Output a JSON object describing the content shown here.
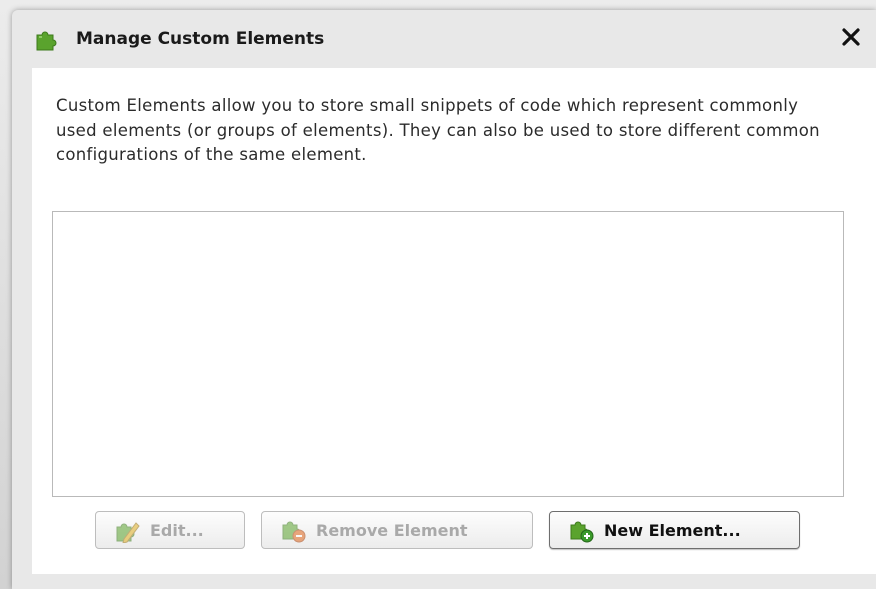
{
  "dialog": {
    "title": "Manage Custom Elements",
    "close_symbol": "✕",
    "title_icon": "puzzle-icon",
    "description": "Custom Elements allow you to store small snippets of code which represent commonly used elements (or groups of elements).  They can also be used to store different common configurations of the same element.",
    "list_items": []
  },
  "buttons": {
    "edit_label": "Edit...",
    "remove_label": "Remove Element",
    "new_label": "New Element..."
  },
  "colors": {
    "puzzle_green": "#5aa32d",
    "pencil_yellow": "#e0b020",
    "remove_orange": "#e0661a",
    "add_green": "#3a9a2a"
  },
  "states": {
    "edit_enabled": false,
    "remove_enabled": false,
    "new_enabled": true
  }
}
